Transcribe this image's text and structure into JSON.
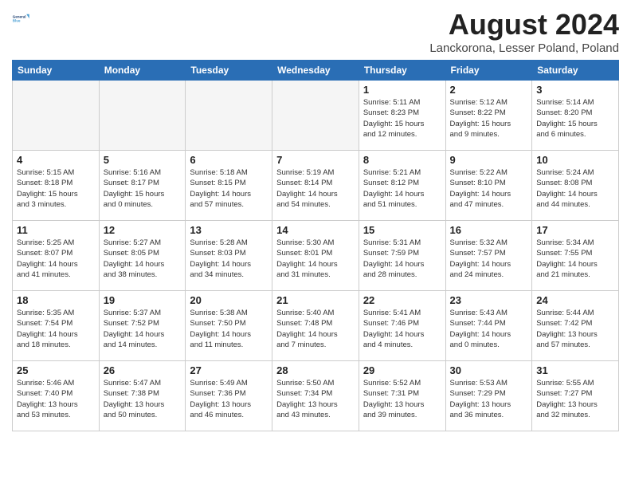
{
  "header": {
    "logo_line1": "General",
    "logo_line2": "Blue",
    "month_title": "August 2024",
    "location": "Lanckorona, Lesser Poland, Poland"
  },
  "weekdays": [
    "Sunday",
    "Monday",
    "Tuesday",
    "Wednesday",
    "Thursday",
    "Friday",
    "Saturday"
  ],
  "weeks": [
    [
      {
        "day": "",
        "info": ""
      },
      {
        "day": "",
        "info": ""
      },
      {
        "day": "",
        "info": ""
      },
      {
        "day": "",
        "info": ""
      },
      {
        "day": "1",
        "info": "Sunrise: 5:11 AM\nSunset: 8:23 PM\nDaylight: 15 hours\nand 12 minutes."
      },
      {
        "day": "2",
        "info": "Sunrise: 5:12 AM\nSunset: 8:22 PM\nDaylight: 15 hours\nand 9 minutes."
      },
      {
        "day": "3",
        "info": "Sunrise: 5:14 AM\nSunset: 8:20 PM\nDaylight: 15 hours\nand 6 minutes."
      }
    ],
    [
      {
        "day": "4",
        "info": "Sunrise: 5:15 AM\nSunset: 8:18 PM\nDaylight: 15 hours\nand 3 minutes."
      },
      {
        "day": "5",
        "info": "Sunrise: 5:16 AM\nSunset: 8:17 PM\nDaylight: 15 hours\nand 0 minutes."
      },
      {
        "day": "6",
        "info": "Sunrise: 5:18 AM\nSunset: 8:15 PM\nDaylight: 14 hours\nand 57 minutes."
      },
      {
        "day": "7",
        "info": "Sunrise: 5:19 AM\nSunset: 8:14 PM\nDaylight: 14 hours\nand 54 minutes."
      },
      {
        "day": "8",
        "info": "Sunrise: 5:21 AM\nSunset: 8:12 PM\nDaylight: 14 hours\nand 51 minutes."
      },
      {
        "day": "9",
        "info": "Sunrise: 5:22 AM\nSunset: 8:10 PM\nDaylight: 14 hours\nand 47 minutes."
      },
      {
        "day": "10",
        "info": "Sunrise: 5:24 AM\nSunset: 8:08 PM\nDaylight: 14 hours\nand 44 minutes."
      }
    ],
    [
      {
        "day": "11",
        "info": "Sunrise: 5:25 AM\nSunset: 8:07 PM\nDaylight: 14 hours\nand 41 minutes."
      },
      {
        "day": "12",
        "info": "Sunrise: 5:27 AM\nSunset: 8:05 PM\nDaylight: 14 hours\nand 38 minutes."
      },
      {
        "day": "13",
        "info": "Sunrise: 5:28 AM\nSunset: 8:03 PM\nDaylight: 14 hours\nand 34 minutes."
      },
      {
        "day": "14",
        "info": "Sunrise: 5:30 AM\nSunset: 8:01 PM\nDaylight: 14 hours\nand 31 minutes."
      },
      {
        "day": "15",
        "info": "Sunrise: 5:31 AM\nSunset: 7:59 PM\nDaylight: 14 hours\nand 28 minutes."
      },
      {
        "day": "16",
        "info": "Sunrise: 5:32 AM\nSunset: 7:57 PM\nDaylight: 14 hours\nand 24 minutes."
      },
      {
        "day": "17",
        "info": "Sunrise: 5:34 AM\nSunset: 7:55 PM\nDaylight: 14 hours\nand 21 minutes."
      }
    ],
    [
      {
        "day": "18",
        "info": "Sunrise: 5:35 AM\nSunset: 7:54 PM\nDaylight: 14 hours\nand 18 minutes."
      },
      {
        "day": "19",
        "info": "Sunrise: 5:37 AM\nSunset: 7:52 PM\nDaylight: 14 hours\nand 14 minutes."
      },
      {
        "day": "20",
        "info": "Sunrise: 5:38 AM\nSunset: 7:50 PM\nDaylight: 14 hours\nand 11 minutes."
      },
      {
        "day": "21",
        "info": "Sunrise: 5:40 AM\nSunset: 7:48 PM\nDaylight: 14 hours\nand 7 minutes."
      },
      {
        "day": "22",
        "info": "Sunrise: 5:41 AM\nSunset: 7:46 PM\nDaylight: 14 hours\nand 4 minutes."
      },
      {
        "day": "23",
        "info": "Sunrise: 5:43 AM\nSunset: 7:44 PM\nDaylight: 14 hours\nand 0 minutes."
      },
      {
        "day": "24",
        "info": "Sunrise: 5:44 AM\nSunset: 7:42 PM\nDaylight: 13 hours\nand 57 minutes."
      }
    ],
    [
      {
        "day": "25",
        "info": "Sunrise: 5:46 AM\nSunset: 7:40 PM\nDaylight: 13 hours\nand 53 minutes."
      },
      {
        "day": "26",
        "info": "Sunrise: 5:47 AM\nSunset: 7:38 PM\nDaylight: 13 hours\nand 50 minutes."
      },
      {
        "day": "27",
        "info": "Sunrise: 5:49 AM\nSunset: 7:36 PM\nDaylight: 13 hours\nand 46 minutes."
      },
      {
        "day": "28",
        "info": "Sunrise: 5:50 AM\nSunset: 7:34 PM\nDaylight: 13 hours\nand 43 minutes."
      },
      {
        "day": "29",
        "info": "Sunrise: 5:52 AM\nSunset: 7:31 PM\nDaylight: 13 hours\nand 39 minutes."
      },
      {
        "day": "30",
        "info": "Sunrise: 5:53 AM\nSunset: 7:29 PM\nDaylight: 13 hours\nand 36 minutes."
      },
      {
        "day": "31",
        "info": "Sunrise: 5:55 AM\nSunset: 7:27 PM\nDaylight: 13 hours\nand 32 minutes."
      }
    ]
  ]
}
